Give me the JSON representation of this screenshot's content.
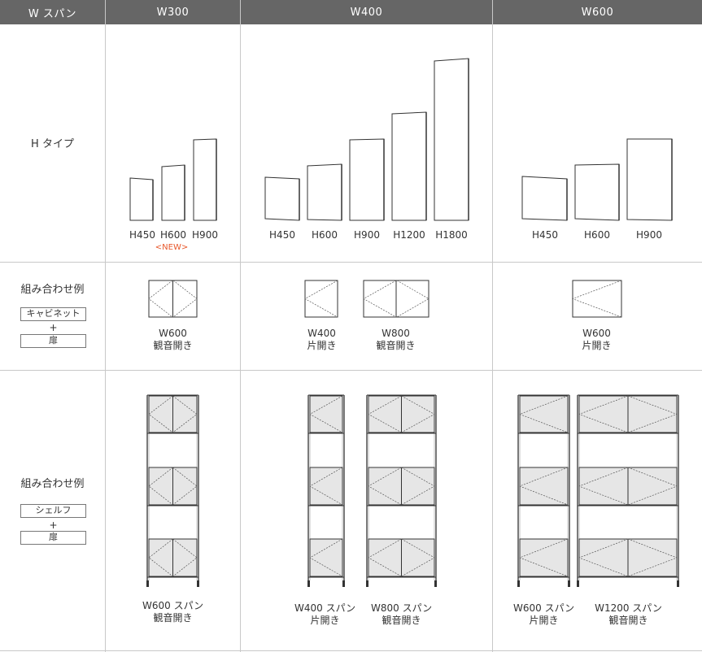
{
  "header": {
    "row_label": "W スパン",
    "w300": "W300",
    "w400": "W400",
    "w600": "W600"
  },
  "h_type": {
    "label": "H タイプ",
    "w300_heights": [
      "H450",
      "H600",
      "H900"
    ],
    "w300_badge": "<NEW>",
    "w400_heights": [
      "H450",
      "H600",
      "H900",
      "H1200",
      "H1800"
    ],
    "w600_heights": [
      "H450",
      "H600",
      "H900"
    ]
  },
  "combo_cabinet": {
    "label": "組み合わせ例",
    "tag1": "キャビネット",
    "plus": "+",
    "tag2": "扉",
    "w300": {
      "size": "W600",
      "door": "観音開き"
    },
    "w400a": {
      "size": "W400",
      "door": "片開き"
    },
    "w400b": {
      "size": "W800",
      "door": "観音開き"
    },
    "w600": {
      "size": "W600",
      "door": "片開き"
    }
  },
  "combo_shelf": {
    "label": "組み合わせ例",
    "tag1": "シェルフ",
    "plus": "+",
    "tag2": "扉",
    "w300": {
      "size": "W600 スパン",
      "door": "観音開き"
    },
    "w400a": {
      "size": "W400 スパン",
      "door": "片開き"
    },
    "w400b": {
      "size": "W800 スパン",
      "door": "観音開き"
    },
    "w600a": {
      "size": "W600 スパン",
      "door": "片開き"
    },
    "w600b": {
      "size": "W1200 スパン",
      "door": "観音開き"
    }
  },
  "colors": {
    "header_bg": "#666666",
    "grid": "#c8c8c8",
    "new_badge": "#e8582b",
    "door_fill": "#e6e6e6"
  }
}
